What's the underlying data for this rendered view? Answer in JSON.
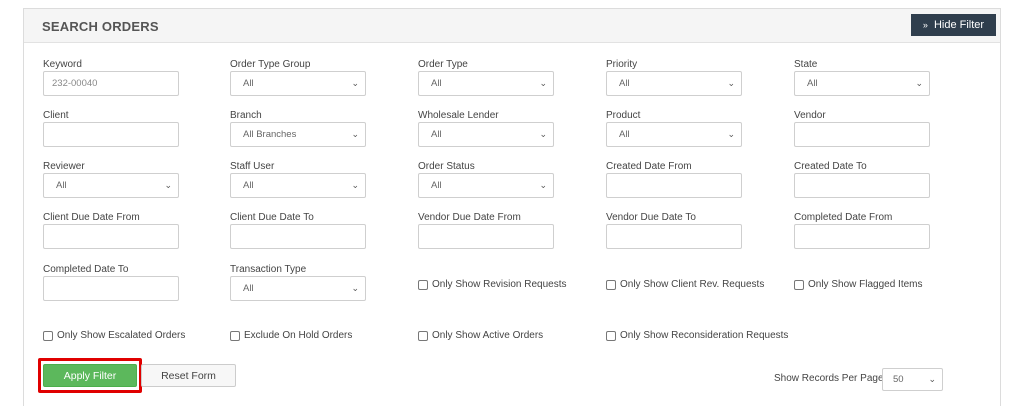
{
  "header": {
    "title": "SEARCH ORDERS",
    "hide_filter_label": "Hide Filter"
  },
  "fields": {
    "keyword": {
      "label": "Keyword",
      "value": "232-00040"
    },
    "order_type_group": {
      "label": "Order Type Group",
      "value": "All"
    },
    "order_type": {
      "label": "Order Type",
      "value": "All"
    },
    "priority": {
      "label": "Priority",
      "value": "All"
    },
    "state": {
      "label": "State",
      "value": "All"
    },
    "client": {
      "label": "Client",
      "value": ""
    },
    "branch": {
      "label": "Branch",
      "value": "All Branches"
    },
    "wholesale_lender": {
      "label": "Wholesale Lender",
      "value": "All"
    },
    "product": {
      "label": "Product",
      "value": "All"
    },
    "vendor": {
      "label": "Vendor",
      "value": ""
    },
    "reviewer": {
      "label": "Reviewer",
      "value": "All"
    },
    "staff_user": {
      "label": "Staff User",
      "value": "All"
    },
    "order_status": {
      "label": "Order Status",
      "value": "All"
    },
    "created_date_from": {
      "label": "Created Date From",
      "value": ""
    },
    "created_date_to": {
      "label": "Created Date To",
      "value": ""
    },
    "client_due_date_from": {
      "label": "Client Due Date From",
      "value": ""
    },
    "client_due_date_to": {
      "label": "Client Due Date To",
      "value": ""
    },
    "vendor_due_date_from": {
      "label": "Vendor Due Date From",
      "value": ""
    },
    "vendor_due_date_to": {
      "label": "Vendor Due Date To",
      "value": ""
    },
    "completed_date_from": {
      "label": "Completed Date From",
      "value": ""
    },
    "completed_date_to": {
      "label": "Completed Date To",
      "value": ""
    },
    "transaction_type": {
      "label": "Transaction Type",
      "value": "All"
    }
  },
  "checkboxes": {
    "revision_requests": "Only Show Revision Requests",
    "client_rev_requests": "Only Show Client Rev. Requests",
    "flagged_items": "Only Show Flagged Items",
    "escalated_orders": "Only Show Escalated Orders",
    "exclude_on_hold": "Exclude On Hold Orders",
    "active_orders": "Only Show Active Orders",
    "reconsideration_requests": "Only Show Reconsideration Requests"
  },
  "actions": {
    "apply_label": "Apply Filter",
    "reset_label": "Reset Form"
  },
  "records": {
    "label": "Show Records Per Page",
    "value": "50"
  },
  "colors": {
    "header_button": "#2f3e4d",
    "apply_button": "#5cb85c",
    "highlight_border": "#e00000"
  },
  "icons": {
    "hide_filter": "double-chevron-up-icon",
    "dropdown": "chevron-down-icon",
    "checkbox": "checkbox-icon"
  }
}
